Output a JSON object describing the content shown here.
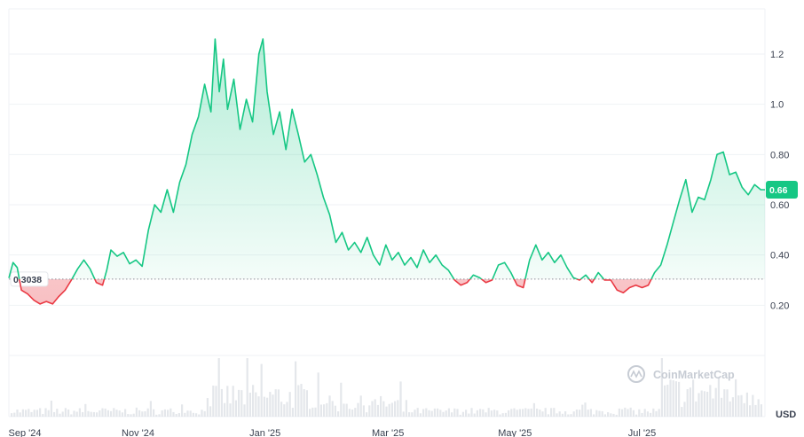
{
  "chart_data": {
    "type": "area",
    "currency": "USD",
    "baseline_value": 0.3038,
    "baseline_label": "0.3038",
    "last_value_label": "0.66",
    "watermark": "CoinMarketCap",
    "y_ticks": [
      {
        "value": 0.2,
        "label": "0.20"
      },
      {
        "value": 0.4,
        "label": "0.40"
      },
      {
        "value": 0.6,
        "label": "0.60"
      },
      {
        "value": 0.8,
        "label": "0.80"
      },
      {
        "value": 1.0,
        "label": "1.0"
      },
      {
        "value": 1.2,
        "label": "1.2"
      }
    ],
    "ylim": [
      0.0,
      1.38
    ],
    "x_ticks": [
      {
        "date": "2024-09-01",
        "label": "Sep '24"
      },
      {
        "date": "2024-11-01",
        "label": "Nov '24"
      },
      {
        "date": "2025-01-01",
        "label": "Jan '25"
      },
      {
        "date": "2025-03-01",
        "label": "Mar '25"
      },
      {
        "date": "2025-05-01",
        "label": "May '25"
      },
      {
        "date": "2025-07-01",
        "label": "Jul '25"
      }
    ],
    "xlim": [
      "2024-08-31",
      "2025-08-29"
    ],
    "colors": {
      "up": "#16c784",
      "down": "#ea3943",
      "grid": "#eff2f5",
      "volume": "#d9dde3",
      "badge": "#16c784"
    },
    "series": [
      {
        "points": [
          [
            "2024-08-31",
            0.308
          ],
          [
            "2024-09-02",
            0.37
          ],
          [
            "2024-09-04",
            0.35
          ],
          [
            "2024-09-06",
            0.26
          ],
          [
            "2024-09-09",
            0.245
          ],
          [
            "2024-09-12",
            0.22
          ],
          [
            "2024-09-15",
            0.205
          ],
          [
            "2024-09-18",
            0.215
          ],
          [
            "2024-09-21",
            0.205
          ],
          [
            "2024-09-24",
            0.235
          ],
          [
            "2024-09-27",
            0.26
          ],
          [
            "2024-09-30",
            0.3
          ],
          [
            "2024-10-03",
            0.345
          ],
          [
            "2024-10-06",
            0.38
          ],
          [
            "2024-10-09",
            0.345
          ],
          [
            "2024-10-12",
            0.29
          ],
          [
            "2024-10-15",
            0.28
          ],
          [
            "2024-10-17",
            0.34
          ],
          [
            "2024-10-19",
            0.42
          ],
          [
            "2024-10-22",
            0.395
          ],
          [
            "2024-10-25",
            0.41
          ],
          [
            "2024-10-28",
            0.365
          ],
          [
            "2024-10-31",
            0.38
          ],
          [
            "2024-11-03",
            0.355
          ],
          [
            "2024-11-06",
            0.5
          ],
          [
            "2024-11-09",
            0.6
          ],
          [
            "2024-11-12",
            0.57
          ],
          [
            "2024-11-15",
            0.66
          ],
          [
            "2024-11-18",
            0.57
          ],
          [
            "2024-11-21",
            0.69
          ],
          [
            "2024-11-24",
            0.76
          ],
          [
            "2024-11-27",
            0.88
          ],
          [
            "2024-11-30",
            0.95
          ],
          [
            "2024-12-03",
            1.08
          ],
          [
            "2024-12-06",
            0.97
          ],
          [
            "2024-12-08",
            1.26
          ],
          [
            "2024-12-10",
            1.05
          ],
          [
            "2024-12-12",
            1.18
          ],
          [
            "2024-12-14",
            0.98
          ],
          [
            "2024-12-17",
            1.1
          ],
          [
            "2024-12-20",
            0.9
          ],
          [
            "2024-12-23",
            1.02
          ],
          [
            "2024-12-26",
            0.93
          ],
          [
            "2024-12-29",
            1.2
          ],
          [
            "2024-12-31",
            1.26
          ],
          [
            "2025-01-02",
            1.05
          ],
          [
            "2025-01-05",
            0.88
          ],
          [
            "2025-01-08",
            0.97
          ],
          [
            "2025-01-11",
            0.82
          ],
          [
            "2025-01-14",
            0.98
          ],
          [
            "2025-01-17",
            0.88
          ],
          [
            "2025-01-20",
            0.77
          ],
          [
            "2025-01-23",
            0.8
          ],
          [
            "2025-01-26",
            0.72
          ],
          [
            "2025-01-29",
            0.63
          ],
          [
            "2025-02-01",
            0.56
          ],
          [
            "2025-02-04",
            0.45
          ],
          [
            "2025-02-07",
            0.49
          ],
          [
            "2025-02-10",
            0.42
          ],
          [
            "2025-02-13",
            0.45
          ],
          [
            "2025-02-16",
            0.41
          ],
          [
            "2025-02-19",
            0.47
          ],
          [
            "2025-02-22",
            0.4
          ],
          [
            "2025-02-25",
            0.36
          ],
          [
            "2025-02-28",
            0.44
          ],
          [
            "2025-03-03",
            0.38
          ],
          [
            "2025-03-06",
            0.41
          ],
          [
            "2025-03-09",
            0.36
          ],
          [
            "2025-03-12",
            0.39
          ],
          [
            "2025-03-15",
            0.35
          ],
          [
            "2025-03-18",
            0.42
          ],
          [
            "2025-03-21",
            0.37
          ],
          [
            "2025-03-24",
            0.4
          ],
          [
            "2025-03-27",
            0.36
          ],
          [
            "2025-03-30",
            0.34
          ],
          [
            "2025-04-02",
            0.3
          ],
          [
            "2025-04-05",
            0.28
          ],
          [
            "2025-04-08",
            0.29
          ],
          [
            "2025-04-11",
            0.32
          ],
          [
            "2025-04-14",
            0.31
          ],
          [
            "2025-04-17",
            0.29
          ],
          [
            "2025-04-20",
            0.3
          ],
          [
            "2025-04-23",
            0.36
          ],
          [
            "2025-04-26",
            0.37
          ],
          [
            "2025-04-29",
            0.33
          ],
          [
            "2025-05-02",
            0.28
          ],
          [
            "2025-05-05",
            0.27
          ],
          [
            "2025-05-08",
            0.38
          ],
          [
            "2025-05-11",
            0.44
          ],
          [
            "2025-05-14",
            0.38
          ],
          [
            "2025-05-17",
            0.41
          ],
          [
            "2025-05-20",
            0.37
          ],
          [
            "2025-05-23",
            0.4
          ],
          [
            "2025-05-26",
            0.35
          ],
          [
            "2025-05-29",
            0.31
          ],
          [
            "2025-06-01",
            0.3
          ],
          [
            "2025-06-04",
            0.32
          ],
          [
            "2025-06-07",
            0.29
          ],
          [
            "2025-06-10",
            0.33
          ],
          [
            "2025-06-13",
            0.3
          ],
          [
            "2025-06-16",
            0.3
          ],
          [
            "2025-06-19",
            0.26
          ],
          [
            "2025-06-22",
            0.25
          ],
          [
            "2025-06-25",
            0.27
          ],
          [
            "2025-06-28",
            0.28
          ],
          [
            "2025-07-01",
            0.27
          ],
          [
            "2025-07-04",
            0.28
          ],
          [
            "2025-07-07",
            0.33
          ],
          [
            "2025-07-10",
            0.36
          ],
          [
            "2025-07-13",
            0.44
          ],
          [
            "2025-07-16",
            0.53
          ],
          [
            "2025-07-19",
            0.62
          ],
          [
            "2025-07-22",
            0.7
          ],
          [
            "2025-07-25",
            0.57
          ],
          [
            "2025-07-28",
            0.63
          ],
          [
            "2025-07-31",
            0.62
          ],
          [
            "2025-08-03",
            0.7
          ],
          [
            "2025-08-06",
            0.8
          ],
          [
            "2025-08-09",
            0.81
          ],
          [
            "2025-08-12",
            0.72
          ],
          [
            "2025-08-15",
            0.73
          ],
          [
            "2025-08-18",
            0.67
          ],
          [
            "2025-08-21",
            0.64
          ],
          [
            "2025-08-24",
            0.68
          ],
          [
            "2025-08-27",
            0.66
          ],
          [
            "2025-08-29",
            0.66
          ]
        ]
      }
    ]
  }
}
